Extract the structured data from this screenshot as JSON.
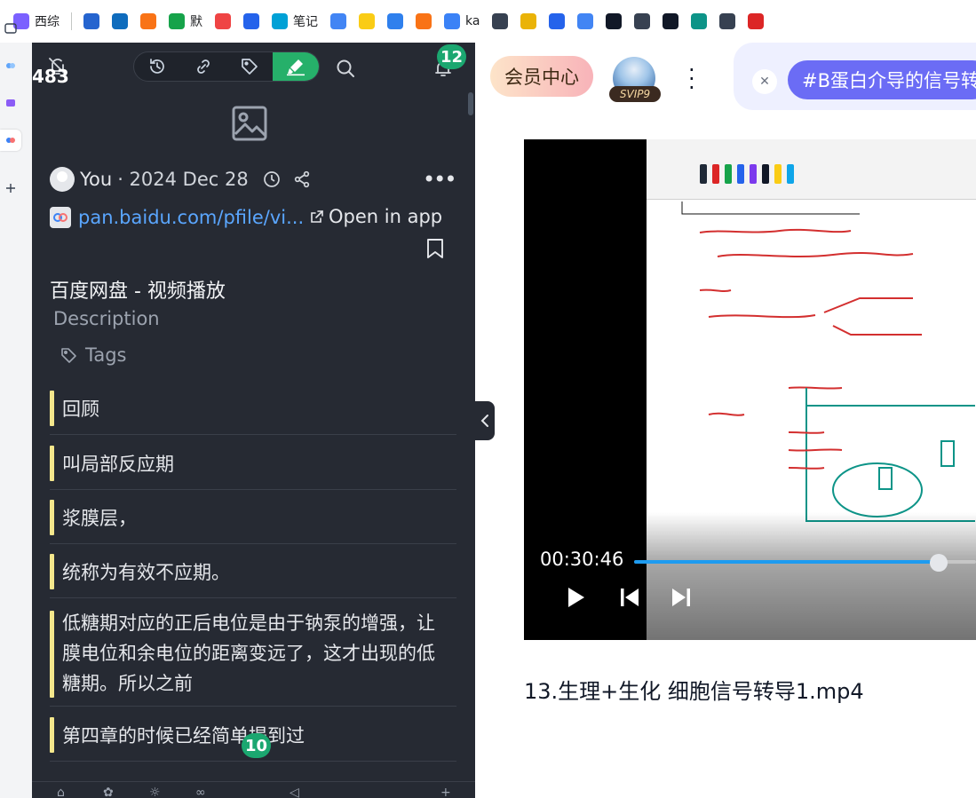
{
  "bookmarks": [
    {
      "icon": "copilot-icon",
      "label": "西综",
      "color": "#7b61ff"
    },
    {
      "icon": "todo-icon",
      "label": "",
      "color": "#2564cf"
    },
    {
      "icon": "outlook-icon",
      "label": "",
      "color": "#0f6cbd"
    },
    {
      "icon": "flame-icon",
      "label": "",
      "color": "#f97316"
    },
    {
      "icon": "green-app-icon",
      "label": "默",
      "color": "#16a34a"
    },
    {
      "icon": "heart-icon",
      "label": "",
      "color": "#ef4444"
    },
    {
      "icon": "cube-icon",
      "label": "",
      "color": "#2563eb"
    },
    {
      "icon": "bilibili-icon",
      "label": "笔记",
      "color": "#00a1d6"
    },
    {
      "icon": "google-icon",
      "label": "",
      "color": "#4285f4"
    },
    {
      "icon": "star-icon",
      "label": "",
      "color": "#facc15"
    },
    {
      "icon": "baidupan-icon",
      "label": "",
      "color": "#2f80ed"
    },
    {
      "icon": "orange-doc-icon",
      "label": "",
      "color": "#f97316"
    },
    {
      "icon": "ka-icon",
      "label": "ka",
      "color": "#3b82f6"
    },
    {
      "icon": "globe-icon",
      "label": "",
      "color": "#374151"
    },
    {
      "icon": "student-icon",
      "label": "",
      "color": "#eab308"
    },
    {
      "icon": "check-icon",
      "label": "",
      "color": "#2563eb"
    },
    {
      "icon": "google-icon-2",
      "label": "",
      "color": "#4285f4"
    },
    {
      "icon": "openai-icon",
      "label": "",
      "color": "#111827"
    },
    {
      "icon": "favorites-icon",
      "label": "",
      "color": "#374151"
    },
    {
      "icon": "slash-icon",
      "label": "",
      "color": "#111827"
    },
    {
      "icon": "teal-app-icon",
      "label": "",
      "color": "#0d9488"
    },
    {
      "icon": "folder-icon",
      "label": "",
      "color": "#374151"
    },
    {
      "icon": "red-app-icon",
      "label": "",
      "color": "#dc2626"
    }
  ],
  "sidebar": {
    "count_unread": "483",
    "notification_count": "12",
    "meta": {
      "user": "You",
      "date": "· 2024 Dec 28"
    },
    "link": {
      "url": "pan.baidu.com/pfile/vi...",
      "open_label": "Open in app"
    },
    "title": "百度网盘 - 视频播放",
    "description_placeholder": "Description",
    "tags_label": "Tags",
    "highlights": [
      "回顾",
      "叫局部反应期",
      "浆膜层，",
      "统称为有效不应期。",
      "低糖期对应的正后电位是由于钠泵的增强，让膜电位和余电位的距离变远了，这才出现的低糖期。所以之前",
      "第四章的时候已经简单提到过"
    ],
    "bottom_badge": "10"
  },
  "right": {
    "vip_label": "会员中心",
    "svip_badge": "SVIP9",
    "tag_pill": "#B蛋白介导的信号转导",
    "player": {
      "time": "00:30:46",
      "progress": 0.89
    },
    "video_title": "13.生理+生化 细胞信号转导1.mp4"
  },
  "colors": {
    "sidebar_bg": "#262a33",
    "accent_green": "#26b06a",
    "highlight_bar": "#f4e78c",
    "link": "#5aa6ff",
    "progress": "#1e9bf0"
  }
}
